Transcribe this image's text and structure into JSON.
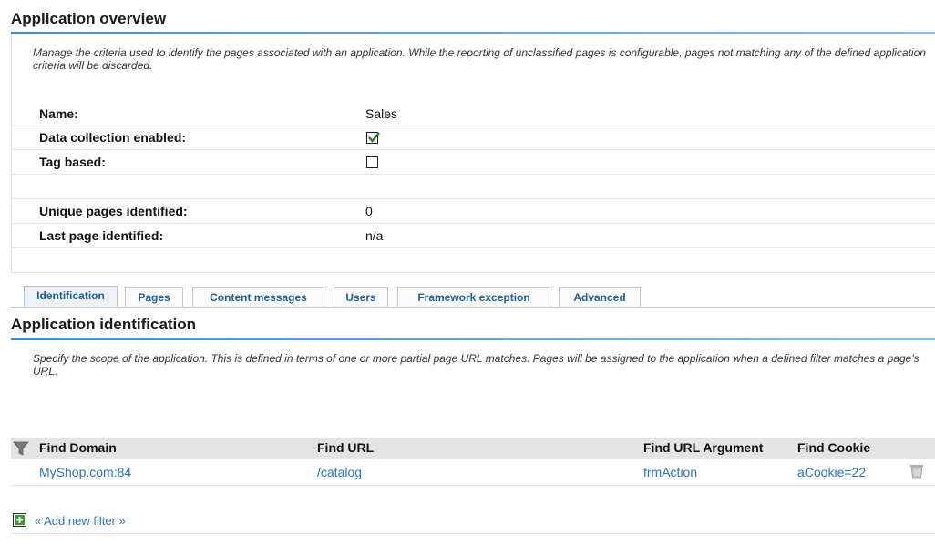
{
  "overview": {
    "title": "Application overview",
    "description": "Manage the criteria used to identify the pages associated with an application. While the reporting of unclassified pages is configurable, pages not matching any of the defined application criteria will be discarded.",
    "name_label": "Name:",
    "name_value": "Sales",
    "data_collection_label": "Data collection enabled:",
    "data_collection_checked": true,
    "tag_based_label": "Tag based:",
    "tag_based_checked": false,
    "unique_pages_label": "Unique pages identified:",
    "unique_pages_value": "0",
    "last_page_label": "Last page identified:",
    "last_page_value": "n/a"
  },
  "tabs": [
    {
      "label": "Identification",
      "active": true
    },
    {
      "label": "Pages",
      "active": false
    },
    {
      "label": "Content messages",
      "active": false
    },
    {
      "label": "Users",
      "active": false
    },
    {
      "label": "Framework exception",
      "active": false
    },
    {
      "label": "Advanced",
      "active": false
    }
  ],
  "identification": {
    "title": "Application identification",
    "description": "Specify the scope of the application. This is defined in terms of one or more partial page URL matches. Pages will be assigned to the application when a defined filter matches a page's URL."
  },
  "table": {
    "headers": [
      "Find Domain",
      "Find URL",
      "Find URL Argument",
      "Find Cookie"
    ],
    "rows": [
      {
        "domain": "MyShop.com:84",
        "url": "/catalog",
        "argument": "frmAction",
        "cookie": "aCookie=22"
      }
    ]
  },
  "add_filter": {
    "label": "« Add new filter »"
  },
  "colors": {
    "accent": "#3a8fd9",
    "link": "#2b73c2",
    "check": "#2e7d32",
    "plus": "#3a9a2a"
  }
}
